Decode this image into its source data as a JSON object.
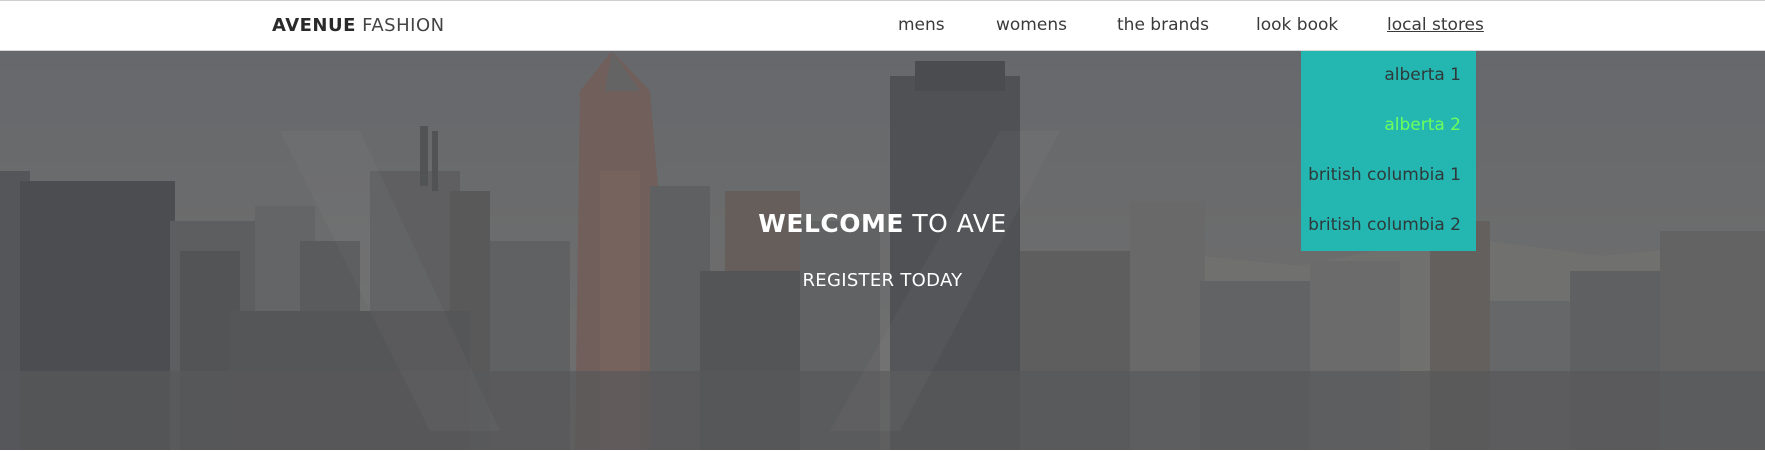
{
  "brand": {
    "bold": "AVENUE",
    "light": "FASHION"
  },
  "nav": {
    "items": [
      {
        "label": "mens"
      },
      {
        "label": "womens"
      },
      {
        "label": "the brands"
      },
      {
        "label": "look book"
      },
      {
        "label": "local stores"
      }
    ]
  },
  "dropdown": {
    "items": [
      {
        "label": "alberta 1"
      },
      {
        "label": "alberta 2"
      },
      {
        "label": "british columbia 1"
      },
      {
        "label": "british columbia 2"
      }
    ],
    "background": "#24b6b1",
    "highlight_color": "#6dff5a"
  },
  "hero": {
    "welcome_bold": "WELCOME",
    "welcome_rest": "TO AVE",
    "register_label": "REGISTER TODAY"
  }
}
